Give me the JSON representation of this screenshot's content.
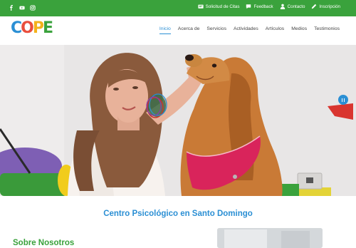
{
  "social": {
    "icons": [
      "facebook-icon",
      "youtube-icon",
      "instagram-icon"
    ]
  },
  "toplinks": [
    {
      "label": "Solicitud de Citas",
      "icon": "form-icon"
    },
    {
      "label": "Feedback",
      "icon": "chat-icon"
    },
    {
      "label": "Contacto",
      "icon": "user-icon"
    },
    {
      "label": "Inscripción",
      "icon": "pencil-icon"
    }
  ],
  "logo": {
    "letters": [
      "C",
      "O",
      "P",
      "E"
    ],
    "colors": [
      "#2b8fd4",
      "#e94e3d",
      "#f3b21b",
      "#3aa23c"
    ]
  },
  "nav": {
    "items": [
      "Inicio",
      "Acerca de",
      "Servicios",
      "Actividades",
      "Artículos",
      "Medios",
      "Testimonios"
    ],
    "active": "Inicio"
  },
  "main": {
    "heading": "Centro Psicológico en Santo Domingo",
    "subheading": "Sobre Nosotros"
  },
  "colors": {
    "topbar": "#3aa23c",
    "accent": "#2b8fd4",
    "green": "#3aa23c"
  }
}
